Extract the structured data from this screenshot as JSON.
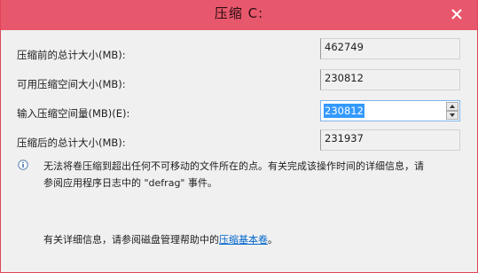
{
  "dialog": {
    "title": "压缩 C:"
  },
  "rows": [
    {
      "label": "压缩前的总计大小(MB):",
      "value": "462749"
    },
    {
      "label": "可用压缩空间大小(MB):",
      "value": "230812"
    },
    {
      "label": "输入压缩空间量(MB)(E):",
      "value": "230812"
    },
    {
      "label": "压缩后的总计大小(MB):",
      "value": "231937"
    }
  ],
  "info": {
    "line1": "无法将卷压缩到超出任何不可移动的文件所在的点。有关完成该操作时间的详细信息，请",
    "line2": "参阅应用程序日志中的 \"defrag\" 事件。"
  },
  "help": {
    "prefix": "有关详细信息，请参阅磁盘管理帮助中的",
    "link": "压缩基本卷",
    "suffix": "。"
  },
  "icons": {
    "close": "close-icon",
    "info": "info-icon",
    "spin_up": "chevron-up-icon",
    "spin_down": "chevron-down-icon"
  },
  "colors": {
    "titlebar": "#e8586c",
    "selection": "#3399ff",
    "link": "#0066cc"
  }
}
